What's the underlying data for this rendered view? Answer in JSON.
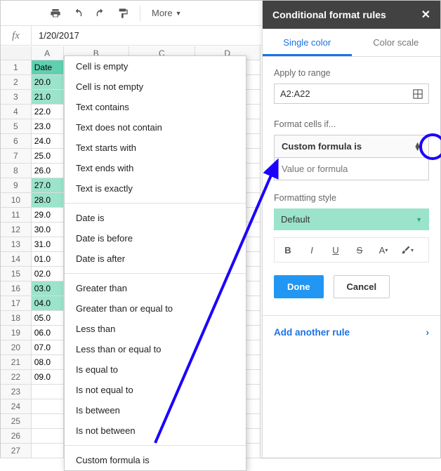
{
  "toolbar": {
    "more_label": "More"
  },
  "formula_bar": {
    "label": "fx",
    "value": "1/20/2017"
  },
  "columns": [
    "A",
    "B",
    "C",
    "D"
  ],
  "rows": [
    {
      "n": 1,
      "a": "Date",
      "hl": "hdr"
    },
    {
      "n": 2,
      "a": "20.0",
      "hl": "hl"
    },
    {
      "n": 3,
      "a": "21.0",
      "hl": "hl"
    },
    {
      "n": 4,
      "a": "22.0",
      "hl": ""
    },
    {
      "n": 5,
      "a": "23.0",
      "hl": ""
    },
    {
      "n": 6,
      "a": "24.0",
      "hl": ""
    },
    {
      "n": 7,
      "a": "25.0",
      "hl": ""
    },
    {
      "n": 8,
      "a": "26.0",
      "hl": ""
    },
    {
      "n": 9,
      "a": "27.0",
      "hl": "hl"
    },
    {
      "n": 10,
      "a": "28.0",
      "hl": "hl"
    },
    {
      "n": 11,
      "a": "29.0",
      "hl": ""
    },
    {
      "n": 12,
      "a": "30.0",
      "hl": ""
    },
    {
      "n": 13,
      "a": "31.0",
      "hl": ""
    },
    {
      "n": 14,
      "a": "01.0",
      "hl": ""
    },
    {
      "n": 15,
      "a": "02.0",
      "hl": ""
    },
    {
      "n": 16,
      "a": "03.0",
      "hl": "hl"
    },
    {
      "n": 17,
      "a": "04.0",
      "hl": "hl"
    },
    {
      "n": 18,
      "a": "05.0",
      "hl": ""
    },
    {
      "n": 19,
      "a": "06.0",
      "hl": ""
    },
    {
      "n": 20,
      "a": "07.0",
      "hl": ""
    },
    {
      "n": 21,
      "a": "08.0",
      "hl": ""
    },
    {
      "n": 22,
      "a": "09.0",
      "hl": ""
    },
    {
      "n": 23,
      "a": "",
      "hl": ""
    },
    {
      "n": 24,
      "a": "",
      "hl": ""
    },
    {
      "n": 25,
      "a": "",
      "hl": ""
    },
    {
      "n": 26,
      "a": "",
      "hl": ""
    },
    {
      "n": 27,
      "a": "",
      "hl": ""
    }
  ],
  "dropdown": {
    "groups": [
      [
        "Cell is empty",
        "Cell is not empty",
        "Text contains",
        "Text does not contain",
        "Text starts with",
        "Text ends with",
        "Text is exactly"
      ],
      [
        "Date is",
        "Date is before",
        "Date is after"
      ],
      [
        "Greater than",
        "Greater than or equal to",
        "Less than",
        "Less than or equal to",
        "Is equal to",
        "Is not equal to",
        "Is between",
        "Is not between"
      ],
      [
        "Custom formula is"
      ]
    ]
  },
  "panel": {
    "title": "Conditional format rules",
    "tab1": "Single color",
    "tab2": "Color scale",
    "apply_label": "Apply to range",
    "range_value": "A2:A22",
    "format_cells_label": "Format cells if...",
    "condition_value": "Custom formula is",
    "formula_placeholder": "Value or formula",
    "style_label": "Formatting style",
    "style_value": "Default",
    "done": "Done",
    "cancel": "Cancel",
    "add_rule": "Add another rule"
  }
}
